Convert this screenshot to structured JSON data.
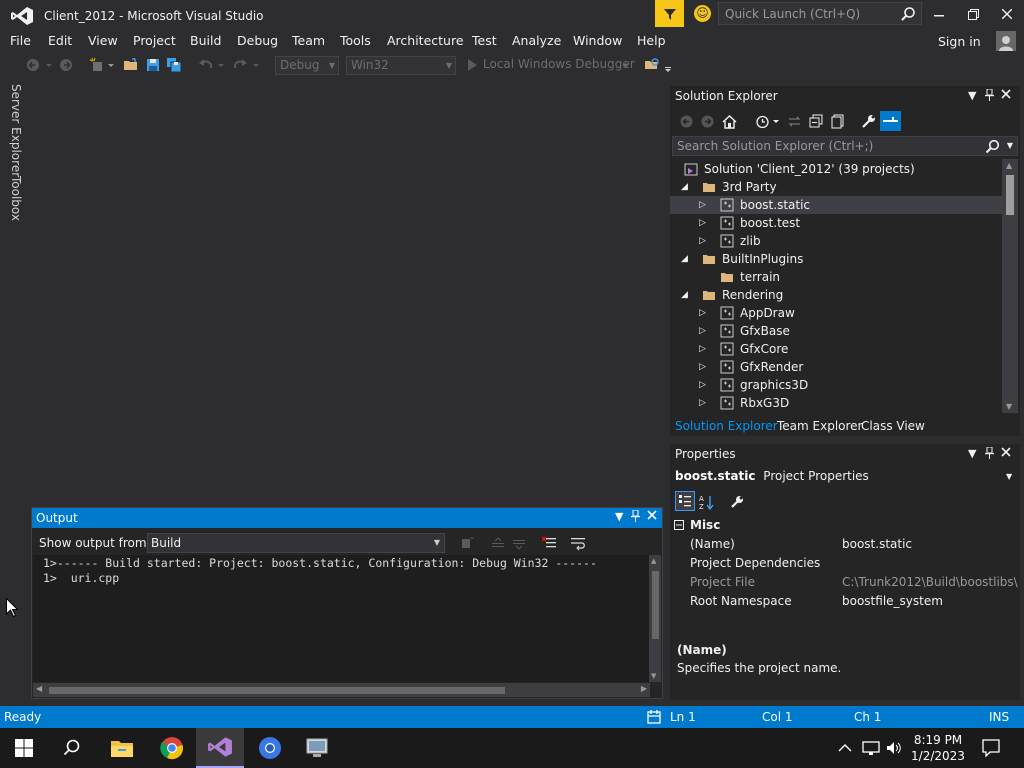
{
  "window": {
    "title": "Client_2012 - Microsoft Visual Studio",
    "quick_launch_placeholder": "Quick Launch (Ctrl+Q)"
  },
  "menu": [
    "File",
    "Edit",
    "View",
    "Project",
    "Build",
    "Debug",
    "Team",
    "Tools",
    "Architecture",
    "Test",
    "Analyze",
    "Window",
    "Help"
  ],
  "account": {
    "sign_in": "Sign in"
  },
  "toolbar": {
    "config": "Debug",
    "platform": "Win32",
    "debugger": "Local Windows Debugger"
  },
  "side_tabs": {
    "server_explorer": "Server Explorer",
    "toolbox": "Toolbox"
  },
  "output": {
    "title": "Output",
    "show_from_label": "Show output from:",
    "source": "Build",
    "lines": [
      "1>------ Build started: Project: boost.static, Configuration: Debug Win32 ------",
      "1>  uri.cpp"
    ]
  },
  "solution_explorer": {
    "title": "Solution Explorer",
    "search_placeholder": "Search Solution Explorer (Ctrl+;)",
    "tree": {
      "solution": "Solution 'Client_2012' (39 projects)",
      "folder_3rdparty": "3rd Party",
      "boost_static": "boost.static",
      "boost_test": "boost.test",
      "zlib": "zlib",
      "folder_builtin": "BuiltInPlugins",
      "terrain": "terrain",
      "folder_rendering": "Rendering",
      "appdraw": "AppDraw",
      "gfxbase": "GfxBase",
      "gfxcore": "GfxCore",
      "gfxrender": "GfxRender",
      "graphics3d": "graphics3D",
      "rbxg3d": "RbxG3D"
    },
    "tabs": [
      "Solution Explorer",
      "Team Explorer",
      "Class View"
    ]
  },
  "properties": {
    "title": "Properties",
    "object_name": "boost.static",
    "object_type": "Project Properties",
    "category": "Misc",
    "rows": [
      {
        "key": "(Name)",
        "value": "boost.static"
      },
      {
        "key": "Project Dependencies",
        "value": ""
      },
      {
        "key": "Project File",
        "value": "C:\\Trunk2012\\Build\\boostlibs\\bo"
      },
      {
        "key": "Root Namespace",
        "value": "boostfile_system"
      }
    ],
    "desc_title": "(Name)",
    "desc_text": "Specifies the project name."
  },
  "status": {
    "state": "Ready",
    "line": "Ln 1",
    "col": "Col 1",
    "ch": "Ch 1",
    "mode": "INS"
  },
  "taskbar": {
    "time": "8:19 PM",
    "date": "1/2/2023"
  },
  "colors": {
    "accent": "#007acc",
    "background": "#2d2d30",
    "panel": "#252526",
    "filter": "#f5c518"
  }
}
